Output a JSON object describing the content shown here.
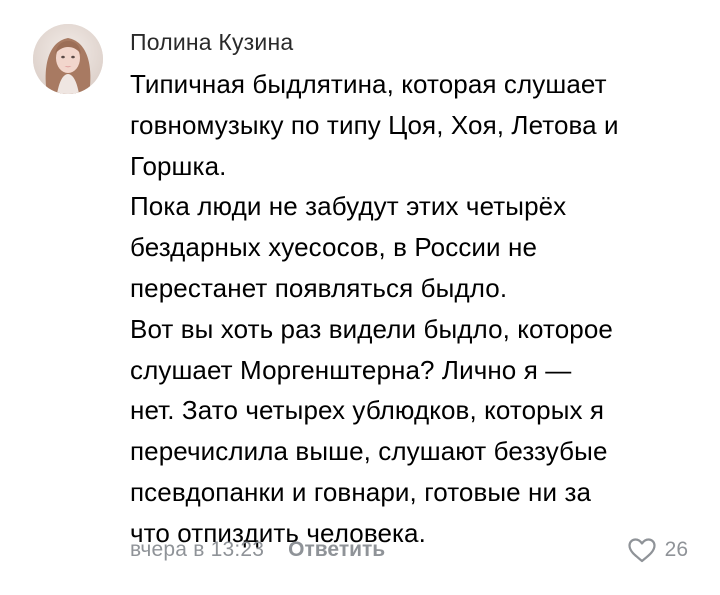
{
  "comment": {
    "author": "Полина Кузина",
    "lines": [
      "Типичная быдлятина, которая слушает",
      "говномузыку по типу Цоя, Хоя, Летова и",
      "Горшка.",
      "Пока люди не забудут этих четырёх",
      "бездарных хуесосов, в России не",
      "перестанет появляться быдло.",
      "Вот вы хоть раз видели быдло, которое",
      "слушает Моргенштерна? Лично я —",
      "нет. Зато четырех ублюдков, которых я",
      "перечислила выше, слушают беззубые",
      "псевдопанки и говнари, готовые ни за",
      "что отпиздить человека."
    ],
    "timestamp": "вчера в 13:23",
    "reply_label": "Ответить",
    "likes_count": "26",
    "like_icon": "heart-outline-icon"
  },
  "colors": {
    "meta_text": "#8f9398",
    "body_text": "#000000"
  }
}
